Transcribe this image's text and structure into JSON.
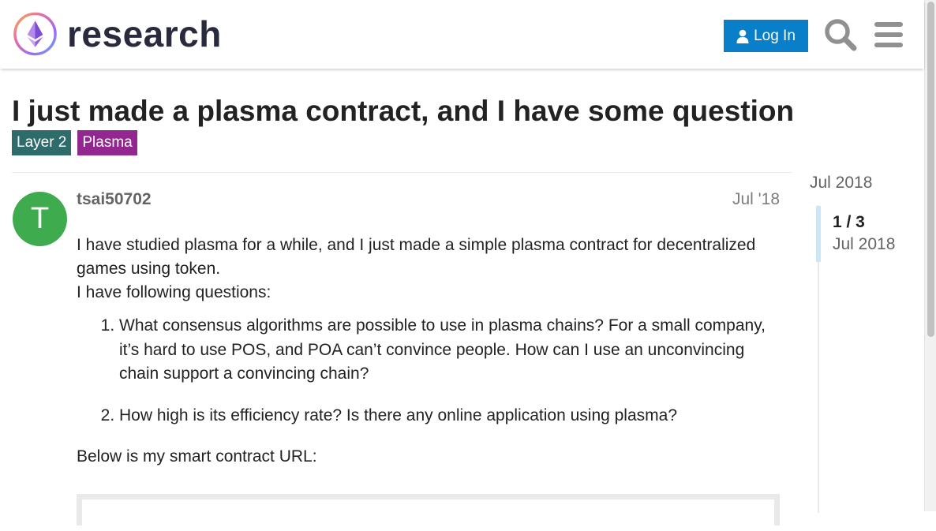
{
  "header": {
    "logo_text": "research",
    "login_label": "Log In",
    "icons": [
      "user-icon",
      "search-icon",
      "menu-icon"
    ]
  },
  "topic": {
    "title": "I just made a plasma contract, and I have some question",
    "tags": [
      "Layer 2",
      "Plasma"
    ],
    "tag_colors": [
      "#2e6b6b",
      "#92278f"
    ]
  },
  "post": {
    "avatar_letter": "T",
    "avatar_color": "#3fab4f",
    "username": "tsai50702",
    "date": "Jul '18",
    "intro": "I have studied plasma for a while, and I just made a simple plasma contract for decentralized games using token.",
    "questions_lead": "I have following questions:",
    "questions": [
      "What consensus algorithms are possible to use in plasma chains? For a small company, it’s hard to use POS, and POA can’t convince people. How can I use an unconvincing chain support a convincing chain?",
      "How high is its efficiency rate? Is there any online application using plasma?"
    ],
    "url_lead": "Below is my smart contract URL:"
  },
  "timeline": {
    "start_date": "Jul 2018",
    "position": "1 / 3",
    "current_date": "Jul 2018"
  },
  "colors": {
    "accent": "#0a7fc9",
    "timeline_handle": "#cde6f5"
  }
}
